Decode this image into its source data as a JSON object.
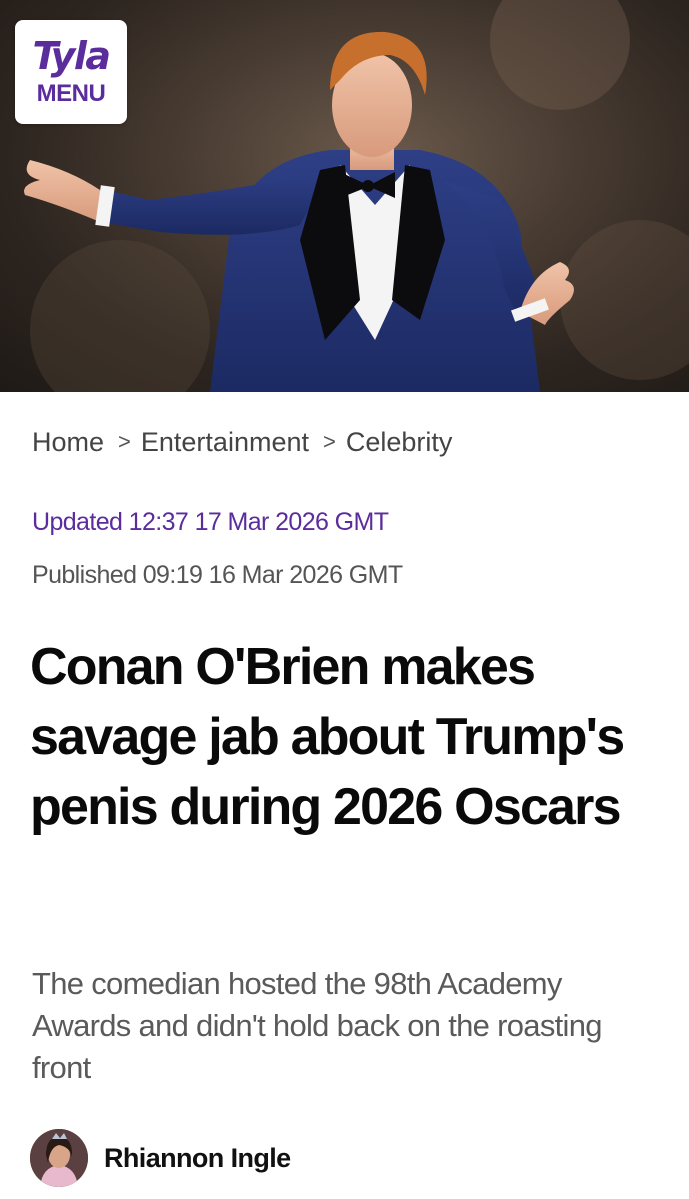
{
  "brand": {
    "logo_text": "Tyla",
    "menu_label": "MENU",
    "accent_color": "#5b2d9c"
  },
  "hero": {
    "icon": "hero-photo"
  },
  "breadcrumb": {
    "items": [
      "Home",
      "Entertainment",
      "Celebrity"
    ],
    "separator": ">"
  },
  "meta": {
    "updated": "Updated 12:37 17 Mar 2026 GMT",
    "published": "Published 09:19 16 Mar 2026 GMT"
  },
  "article": {
    "headline": "Conan O'Brien makes savage jab about Trump's penis during 2026 Oscars",
    "standfirst": "The comedian hosted the 98th Academy Awards and didn't hold back on the roasting front"
  },
  "author": {
    "name": "Rhiannon Ingle"
  }
}
